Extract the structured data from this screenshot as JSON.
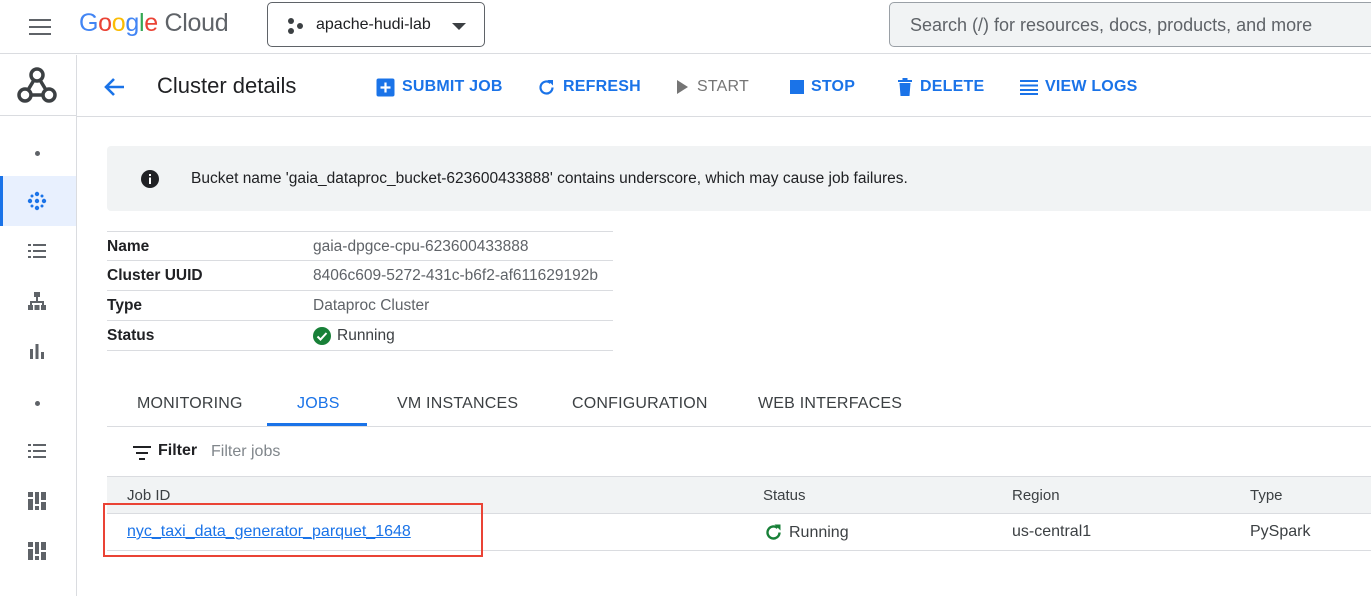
{
  "topbar": {
    "logo_google": "Google",
    "logo_cloud": "Cloud",
    "project_name": "apache-hudi-lab",
    "search_placeholder": "Search (/) for resources, docs, products, and more"
  },
  "actions": {
    "page_title": "Cluster details",
    "submit_job": "SUBMIT JOB",
    "refresh": "REFRESH",
    "start": "START",
    "stop": "STOP",
    "delete": "DELETE",
    "view_logs": "VIEW LOGS"
  },
  "warning": {
    "text": "Bucket name 'gaia_dataproc_bucket-623600433888' contains underscore, which may cause job failures."
  },
  "details": [
    {
      "key": "Name",
      "value": "gaia-dpgce-cpu-623600433888"
    },
    {
      "key": "Cluster UUID",
      "value": "8406c609-5272-431c-b6f2-af611629192b"
    },
    {
      "key": "Type",
      "value": "Dataproc Cluster"
    },
    {
      "key": "Status",
      "value": "Running"
    }
  ],
  "tabs": [
    "MONITORING",
    "JOBS",
    "VM INSTANCES",
    "CONFIGURATION",
    "WEB INTERFACES"
  ],
  "active_tab": "JOBS",
  "filter": {
    "label": "Filter",
    "placeholder": "Filter jobs"
  },
  "jobs_table": {
    "columns": [
      "Job ID",
      "Status",
      "Region",
      "Type"
    ],
    "rows": [
      {
        "job_id": "nyc_taxi_data_generator_parquet_1648",
        "status": "Running",
        "region": "us-central1",
        "type": "PySpark"
      }
    ]
  },
  "colors": {
    "accent": "#1a73e8",
    "success": "#188038",
    "highlight_box": "#ea4335"
  }
}
